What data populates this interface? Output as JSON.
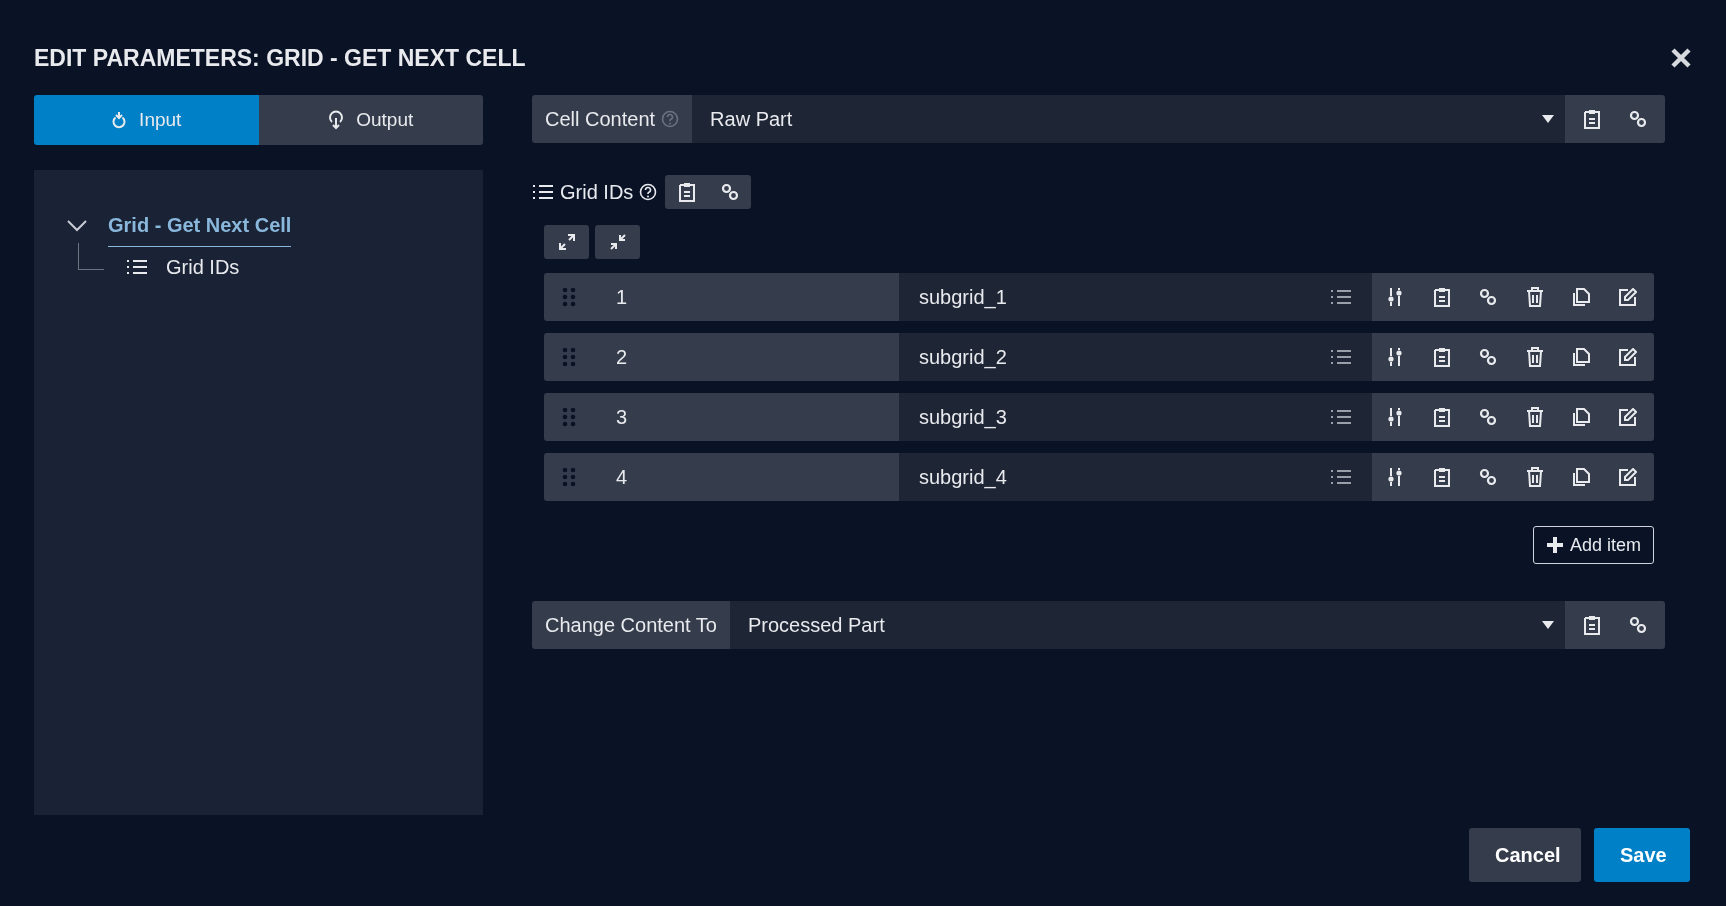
{
  "dialog": {
    "title": "EDIT PARAMETERS: GRID - GET NEXT CELL"
  },
  "tabs": [
    {
      "label": "Input",
      "kind": "input",
      "selected": true
    },
    {
      "label": "Output",
      "kind": "output",
      "selected": false
    }
  ],
  "tree": [
    {
      "label": "Grid - Get Next Cell",
      "selected": true,
      "expanded": true,
      "children": [
        {
          "label": "Grid IDs",
          "selected": false
        }
      ]
    }
  ],
  "cell_content": {
    "label": "Cell Content",
    "help": true,
    "value": "Raw Part"
  },
  "grid_ids": {
    "label": "Grid IDs",
    "help": true,
    "items": [
      {
        "index": "1",
        "value": "subgrid_1"
      },
      {
        "index": "2",
        "value": "subgrid_2"
      },
      {
        "index": "3",
        "value": "subgrid_3"
      },
      {
        "index": "4",
        "value": "subgrid_4"
      }
    ],
    "add_label": "Add item"
  },
  "change_content": {
    "label": "Change Content To",
    "help": false,
    "value": "Processed Part"
  },
  "buttons": [
    {
      "label": "Cancel",
      "kind": "secondary"
    },
    {
      "label": "Save",
      "kind": "primary"
    }
  ]
}
